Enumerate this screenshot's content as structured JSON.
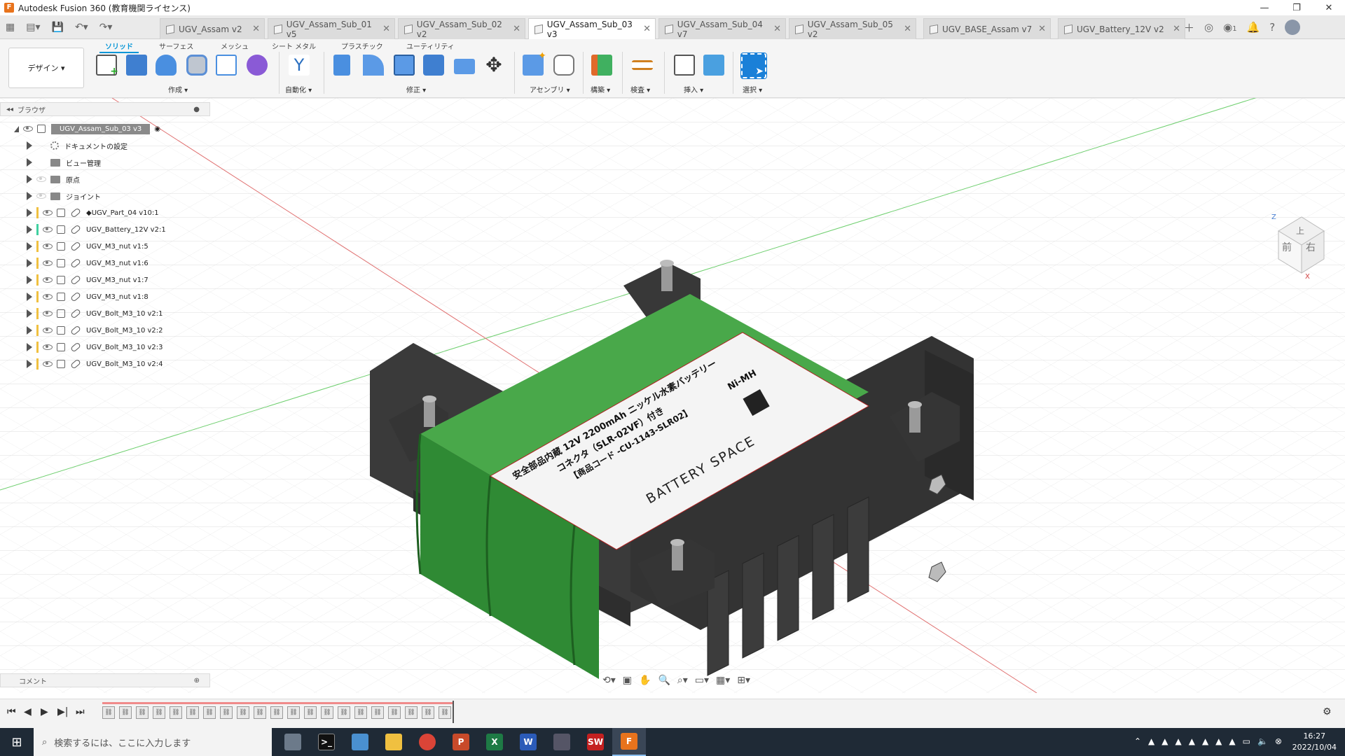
{
  "window": {
    "title": "Autodesk Fusion 360 (教育機関ライセンス)",
    "minimize": "—",
    "maximize": "❐",
    "close": "✕"
  },
  "tabs": [
    {
      "label": "UGV_Assam v2",
      "active": false
    },
    {
      "label": "UGV_Assam_Sub_01 v5",
      "active": false
    },
    {
      "label": "UGV_Assam_Sub_02 v2",
      "active": false
    },
    {
      "label": "UGV_Assam_Sub_03 v3",
      "active": true
    },
    {
      "label": "UGV_Assam_Sub_04 v7",
      "active": false
    },
    {
      "label": "UGV_Assam_Sub_05 v2",
      "active": false
    },
    {
      "label": "UGV_BASE_Assam v7",
      "active": false
    },
    {
      "label": "UGV_Battery_12V v2",
      "active": false
    }
  ],
  "tabbar": {
    "notifications_count": "1"
  },
  "ribbon": {
    "design_label": "デザイン",
    "tabs": [
      "ソリッド",
      "サーフェス",
      "メッシュ",
      "シート メタル",
      "プラスチック",
      "ユーティリティ"
    ],
    "groups": [
      "作成 ▾",
      "自動化 ▾",
      "修正 ▾",
      "アセンブリ ▾",
      "構築 ▾",
      "検査 ▾",
      "挿入 ▾",
      "選択 ▾"
    ]
  },
  "browser": {
    "title": "ブラウザ",
    "root": "UGV_Assam_Sub_03 v3",
    "folders": [
      "ドキュメントの設定",
      "ビュー管理",
      "原点",
      "ジョイント"
    ],
    "components": [
      {
        "label": "◆UGV_Part_04 v10:1",
        "color": "#f0c040"
      },
      {
        "label": "UGV_Battery_12V v2:1",
        "color": "#40d0a0"
      },
      {
        "label": "UGV_M3_nut v1:5",
        "color": "#f0c040"
      },
      {
        "label": "UGV_M3_nut v1:6",
        "color": "#f0c040"
      },
      {
        "label": "UGV_M3_nut v1:7",
        "color": "#f0c040"
      },
      {
        "label": "UGV_M3_nut v1:8",
        "color": "#f0c040"
      },
      {
        "label": "UGV_Bolt_M3_10 v2:1",
        "color": "#f0c040"
      },
      {
        "label": "UGV_Bolt_M3_10 v2:2",
        "color": "#f0c040"
      },
      {
        "label": "UGV_Bolt_M3_10 v2:3",
        "color": "#f0c040"
      },
      {
        "label": "UGV_Bolt_M3_10 v2:4",
        "color": "#f0c040"
      }
    ]
  },
  "comments": {
    "title": "コメント"
  },
  "viewcube": {
    "front": "前",
    "right": "右",
    "top": "上",
    "axis_z": "Z",
    "axis_x": "X"
  },
  "battery_label": {
    "line1": "安全部品内蔵 12V 2200mAh ニッケル水素バッテリー",
    "line2": "コネクタ（SLR-02VF）付き",
    "line3": "【商品コード -CU-1143-SLR02】",
    "brand": "BATTERY SPACE",
    "chem": "Ni-MH"
  },
  "taskbar": {
    "search_placeholder": "検索するには、ここに入力します",
    "time": "16:27",
    "date": "2022/10/04"
  }
}
